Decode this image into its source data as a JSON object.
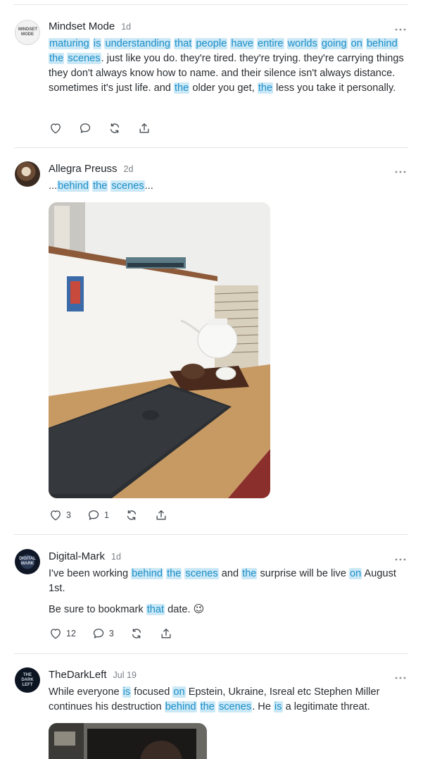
{
  "posts": [
    {
      "author": "Mindset Mode",
      "time": "1d",
      "avatar_text": "MINDSET MODE",
      "segments": [
        {
          "t": "maturing",
          "h": true
        },
        {
          "t": " "
        },
        {
          "t": "is",
          "h": true
        },
        {
          "t": " "
        },
        {
          "t": "understanding",
          "h": true
        },
        {
          "t": " "
        },
        {
          "t": "that",
          "h": true
        },
        {
          "t": " "
        },
        {
          "t": "people",
          "h": true
        },
        {
          "t": " "
        },
        {
          "t": "have",
          "h": true
        },
        {
          "t": " "
        },
        {
          "t": "entire",
          "h": true
        },
        {
          "t": " "
        },
        {
          "t": "worlds",
          "h": true
        },
        {
          "t": " "
        },
        {
          "t": "going",
          "h": true
        },
        {
          "t": " "
        },
        {
          "t": "on",
          "h": true
        },
        {
          "t": " "
        },
        {
          "t": "behind",
          "h": true
        },
        {
          "t": " "
        },
        {
          "t": "the",
          "h": true
        },
        {
          "t": " "
        },
        {
          "t": "scenes",
          "h": true
        },
        {
          "t": ". just like you do. they're tired. they're trying. they're carrying things they don't always know how to name. and their silence isn't always distance. sometimes it's just life. and "
        },
        {
          "t": "the",
          "h": true
        },
        {
          "t": " older you get, "
        },
        {
          "t": "the",
          "h": true
        },
        {
          "t": " less you take it personally."
        }
      ],
      "likes": "",
      "comments": ""
    },
    {
      "author": "Allegra Preuss",
      "time": "2d",
      "segments": [
        {
          "t": "..."
        },
        {
          "t": "behind",
          "h": true
        },
        {
          "t": " "
        },
        {
          "t": "the",
          "h": true
        },
        {
          "t": " "
        },
        {
          "t": "scenes",
          "h": true
        },
        {
          "t": "..."
        }
      ],
      "likes": "3",
      "comments": "1"
    },
    {
      "author": "Digital-Mark",
      "time": "1d",
      "avatar_text": "DIGITAL MARK",
      "segments": [
        {
          "t": "I've been working "
        },
        {
          "t": "behind",
          "h": true
        },
        {
          "t": " "
        },
        {
          "t": "the",
          "h": true
        },
        {
          "t": " "
        },
        {
          "t": "scenes",
          "h": true
        },
        {
          "t": " and "
        },
        {
          "t": "the",
          "h": true
        },
        {
          "t": " surprise will be live "
        },
        {
          "t": "on",
          "h": true
        },
        {
          "t": " August 1st."
        }
      ],
      "segments2": [
        {
          "t": "Be sure to bookmark "
        },
        {
          "t": "that",
          "h": true
        },
        {
          "t": " date. "
        }
      ],
      "emoji": "😉",
      "likes": "12",
      "comments": "3"
    },
    {
      "author": "TheDarkLeft",
      "time": "Jul 19",
      "avatar_text": "THE DARK LEFT",
      "segments": [
        {
          "t": "While everyone "
        },
        {
          "t": "is",
          "h": true
        },
        {
          "t": " focused "
        },
        {
          "t": "on",
          "h": true
        },
        {
          "t": " Epstein, Ukraine, Isreal etc Stephen Miller continues his destruction "
        },
        {
          "t": "behind",
          "h": true
        },
        {
          "t": " "
        },
        {
          "t": "the",
          "h": true
        },
        {
          "t": " "
        },
        {
          "t": "scenes",
          "h": true
        },
        {
          "t": ". He "
        },
        {
          "t": "is",
          "h": true
        },
        {
          "t": " a legitimate threat."
        }
      ]
    }
  ],
  "colors": {
    "highlight_bg": "#cbe8f6",
    "highlight_text": "#1c8fc9"
  }
}
